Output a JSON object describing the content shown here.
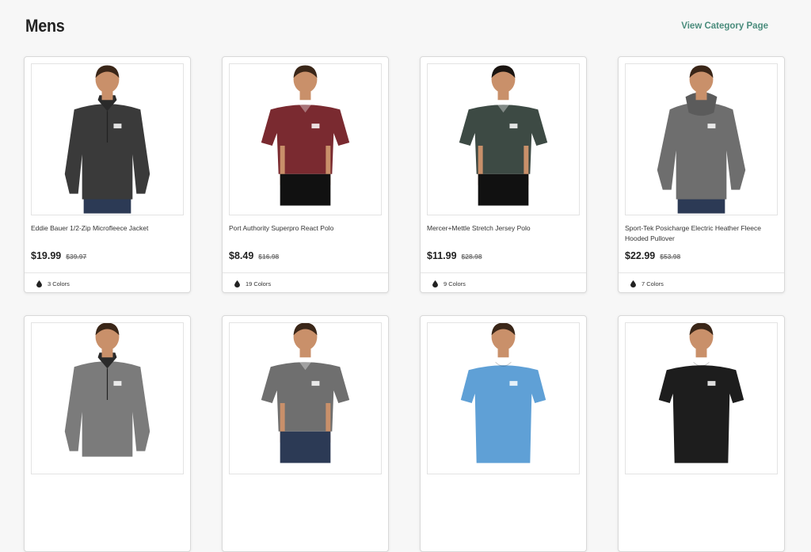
{
  "section": {
    "title": "Mens",
    "view_link": "View Category Page"
  },
  "products": [
    {
      "name": "Eddie Bauer 1/2-Zip Microfleece Jacket",
      "price": "$19.99",
      "old_price": "$39.97",
      "colors": "3 Colors",
      "garment_color": "#3a3a3a",
      "type": "zip-jacket"
    },
    {
      "name": "Port Authority Superpro React Polo",
      "price": "$8.49",
      "old_price": "$16.98",
      "colors": "19 Colors",
      "garment_color": "#7a2a30",
      "type": "polo"
    },
    {
      "name": "Mercer+Mettle Stretch Jersey Polo",
      "price": "$11.99",
      "old_price": "$28.98",
      "colors": "9 Colors",
      "garment_color": "#3d4a44",
      "type": "polo"
    },
    {
      "name": "Sport-Tek Posicharge Electric Heather Fleece Hooded Pullover",
      "price": "$22.99",
      "old_price": "$53.98",
      "colors": "7 Colors",
      "garment_color": "#6e6e6e",
      "type": "hoodie"
    },
    {
      "name": "",
      "price": "",
      "old_price": "",
      "colors": "",
      "garment_color": "#7b7b7b",
      "type": "quarter-zip"
    },
    {
      "name": "",
      "price": "",
      "old_price": "",
      "colors": "",
      "garment_color": "#6f6f6f",
      "type": "polo"
    },
    {
      "name": "",
      "price": "",
      "old_price": "",
      "colors": "",
      "garment_color": "#5fa0d6",
      "type": "tee"
    },
    {
      "name": "",
      "price": "",
      "old_price": "",
      "colors": "",
      "garment_color": "#1d1d1d",
      "type": "tee"
    }
  ]
}
